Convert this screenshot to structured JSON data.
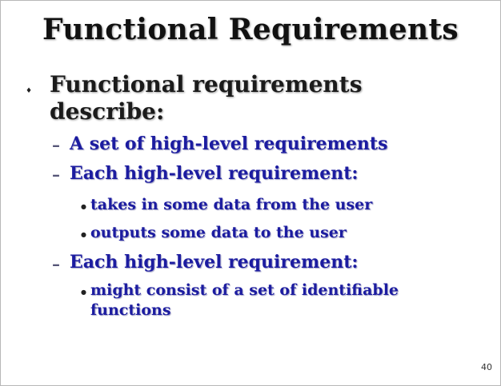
{
  "slide": {
    "title": "Functional Requirements",
    "page_number": "40",
    "bullets": [
      {
        "text": "Functional requirements describe:",
        "sub": [
          {
            "text": "A set of high-level requirements"
          },
          {
            "text": "Each high-level requirement:",
            "sub": [
              {
                "text": "takes in some data from the user"
              },
              {
                "text": "outputs some data to the user"
              }
            ]
          },
          {
            "text": "Each high-level requirement:",
            "sub": [
              {
                "text": "might consist of a set of identifiable functions"
              }
            ]
          }
        ]
      }
    ]
  }
}
